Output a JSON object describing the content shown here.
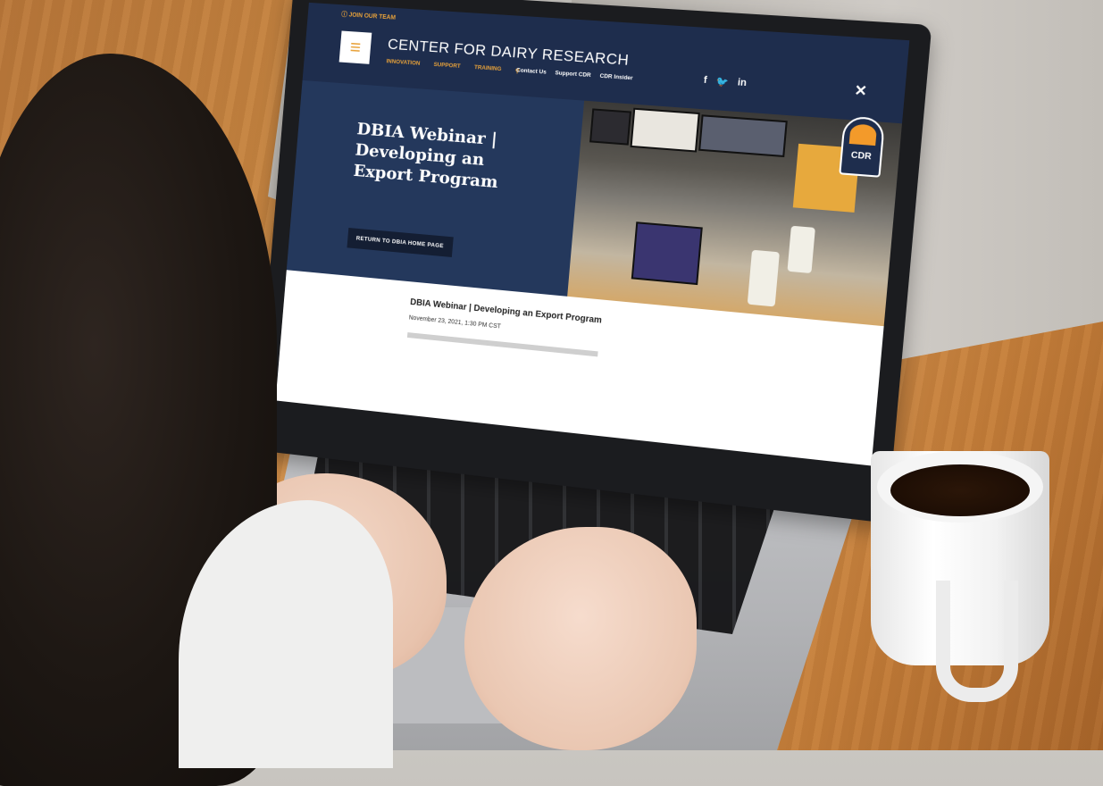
{
  "site": {
    "top_link": "JOIN OUR TEAM",
    "title": "CENTER FOR DAIRY RESEARCH",
    "menu_icon": "hamburger-icon",
    "nav_primary": [
      "INNOVATION",
      "SUPPORT",
      "TRAINING"
    ],
    "nav_secondary": [
      "Contact Us",
      "Support CDR",
      "CDR Insider"
    ],
    "social": [
      "f",
      "twitter-icon",
      "in"
    ],
    "logo_text": "CDR"
  },
  "hero": {
    "title": "DBIA Webinar | Developing an Export Program",
    "button_label": "RETURN TO DBIA HOME PAGE"
  },
  "article": {
    "title": "DBIA Webinar | Developing an Export Program",
    "date": "November 23, 2021, 1:30 PM CST"
  },
  "colors": {
    "navy": "#1e2d4d",
    "hero_blue": "#24385c",
    "accent_orange": "#e8a23a"
  }
}
